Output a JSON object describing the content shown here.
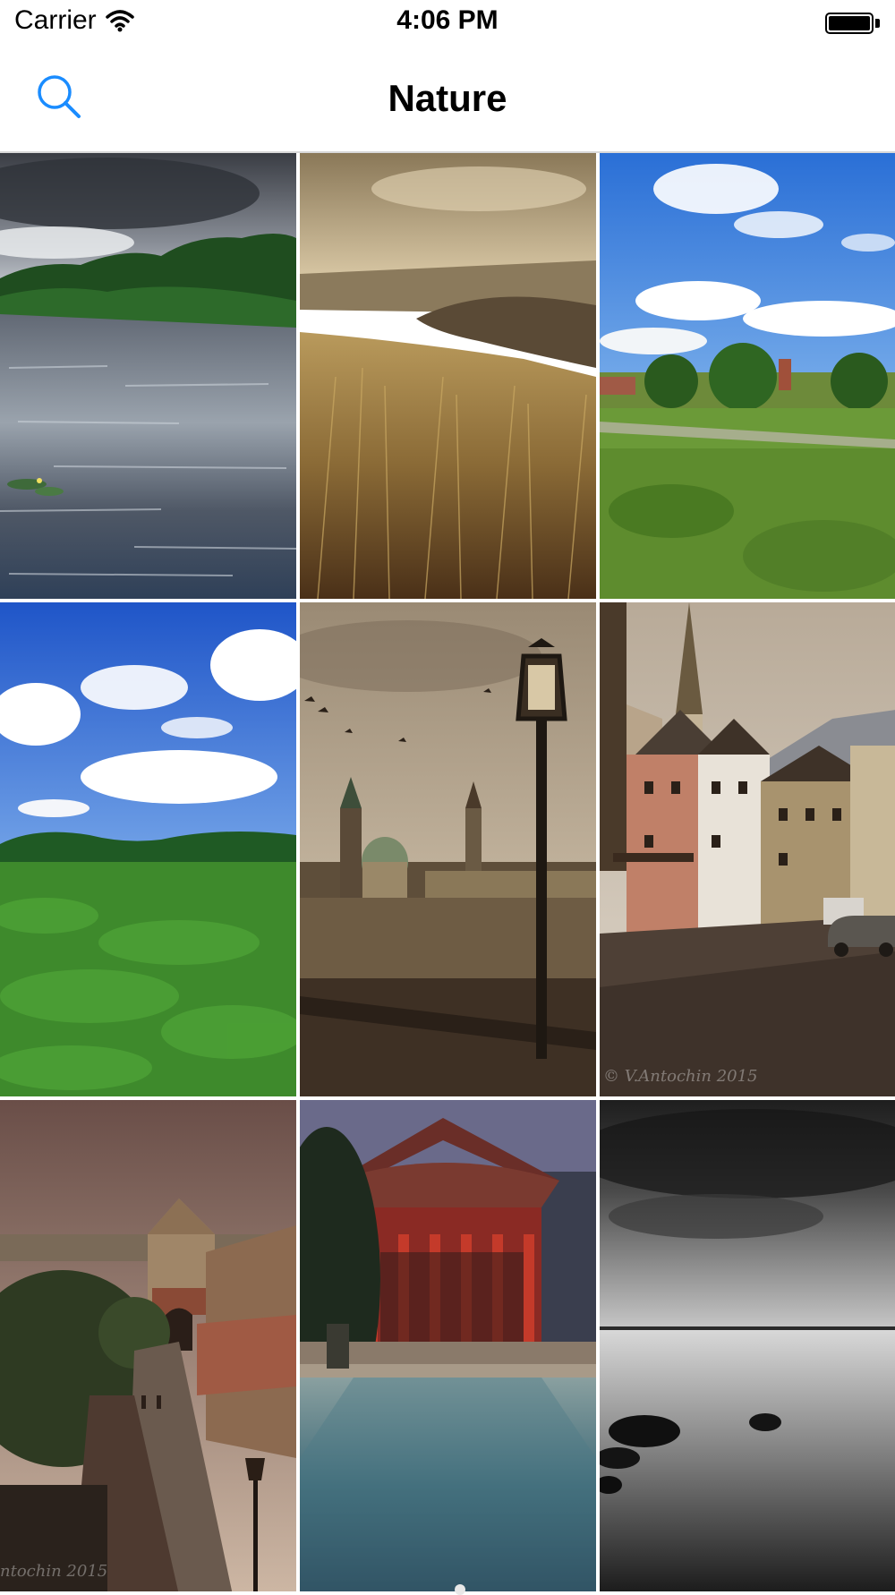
{
  "status_bar": {
    "carrier": "Carrier",
    "time": "4:06 PM",
    "icons": [
      "wifi-icon",
      "battery-icon"
    ]
  },
  "nav": {
    "title": "Nature",
    "search_icon": "search-icon"
  },
  "colors": {
    "accent": "#1a8cff",
    "separator": "#d8d8d8"
  },
  "grid": {
    "photos": [
      {
        "scene": "river with clouds"
      },
      {
        "scene": "sepia grass field"
      },
      {
        "scene": "green park with ruins"
      },
      {
        "scene": "green meadow blue sky"
      },
      {
        "scene": "sepia city with street lamp"
      },
      {
        "scene": "village street with church"
      },
      {
        "scene": "castle alley"
      },
      {
        "scene": "red temple"
      },
      {
        "scene": "black and white lake"
      }
    ],
    "watermarks": {
      "photo_6": "© V.Antochin 2015",
      "photo_7": "ntochin 2015"
    }
  }
}
